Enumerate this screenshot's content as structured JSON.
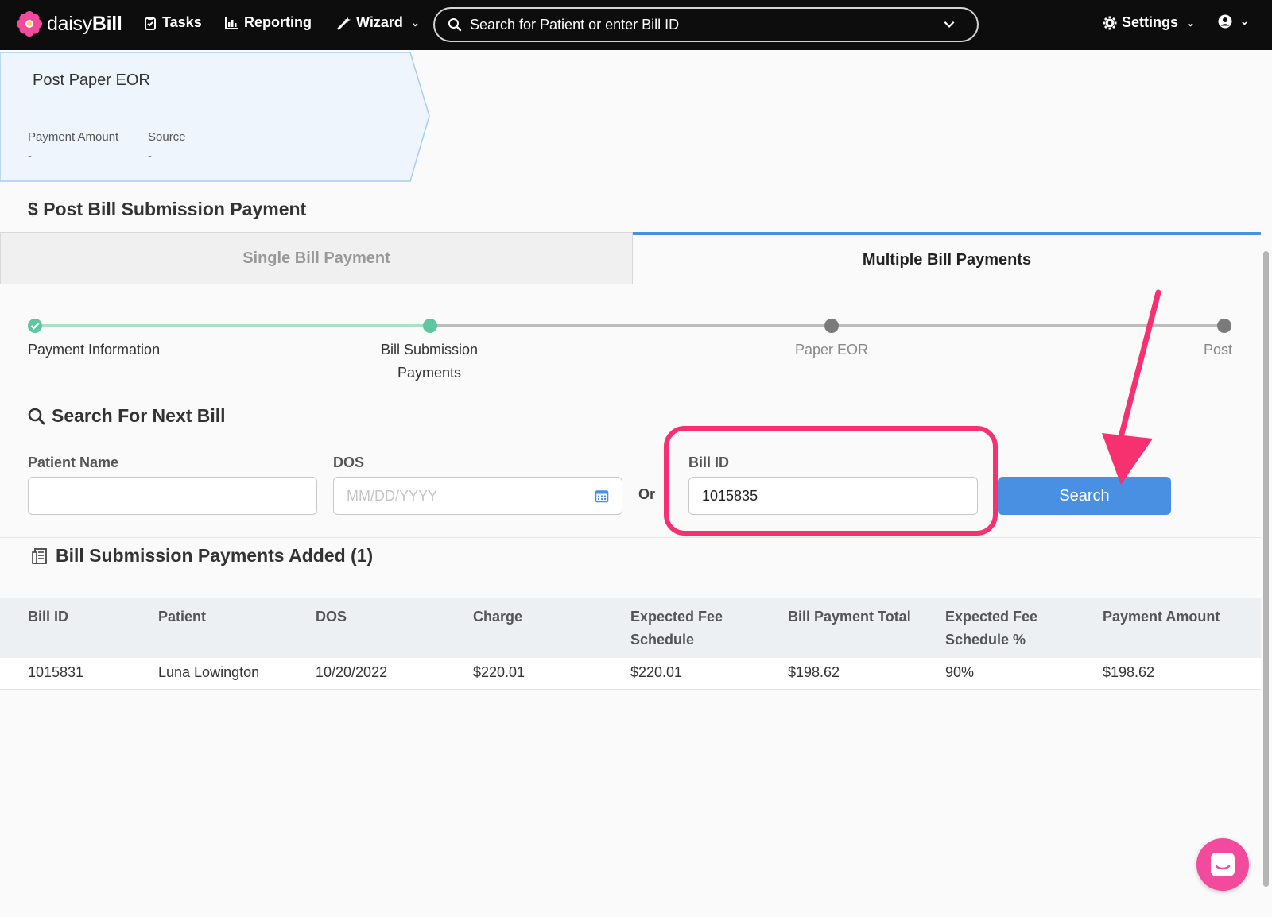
{
  "nav": {
    "brand_light": "daisy",
    "brand_bold": "Bill",
    "tasks": "Tasks",
    "reporting": "Reporting",
    "wizard": "Wizard",
    "search_placeholder": "Search for Patient or enter Bill ID",
    "settings": "Settings"
  },
  "eor": {
    "title": "Post Paper EOR",
    "payment_amount_label": "Payment Amount",
    "payment_amount_value": "-",
    "source_label": "Source",
    "source_value": "-"
  },
  "panel": {
    "title": "Post Bill Submission Payment",
    "tabs": [
      {
        "label": "Single Bill Payment",
        "active": false
      },
      {
        "label": "Multiple Bill Payments",
        "active": true
      }
    ]
  },
  "stepper": [
    {
      "label": "Payment Information",
      "state": "done"
    },
    {
      "label": "Bill Submission",
      "label2": "Payments",
      "state": "current"
    },
    {
      "label": "Paper EOR",
      "state": "upcoming"
    },
    {
      "label": "Post",
      "state": "upcoming"
    }
  ],
  "search_form": {
    "title": "Search For Next Bill",
    "patient_label": "Patient Name",
    "patient_value": "",
    "dos_label": "DOS",
    "dos_placeholder": "MM/DD/YYYY",
    "or_label": "Or",
    "bill_id_label": "Bill ID",
    "bill_id_value": "1015835",
    "search_button": "Search"
  },
  "added": {
    "title": "Bill Submission Payments Added (1)",
    "columns": [
      {
        "line1": "Bill ID",
        "line2": ""
      },
      {
        "line1": "Patient",
        "line2": ""
      },
      {
        "line1": "DOS",
        "line2": ""
      },
      {
        "line1": "Charge",
        "line2": ""
      },
      {
        "line1": "Expected Fee",
        "line2": "Schedule"
      },
      {
        "line1": "Bill Payment Total",
        "line2": ""
      },
      {
        "line1": "Expected Fee",
        "line2": "Schedule %"
      },
      {
        "line1": "Payment Amount",
        "line2": ""
      }
    ],
    "rows": [
      [
        "1015831",
        "Luna Lowington",
        "10/20/2022",
        "$220.01",
        "$220.01",
        "$198.62",
        "90%",
        "$198.62"
      ]
    ]
  },
  "colors": {
    "accent_blue": "#4a90e2",
    "highlight_pink": "#f7306f",
    "step_done": "#5cc7a0"
  }
}
